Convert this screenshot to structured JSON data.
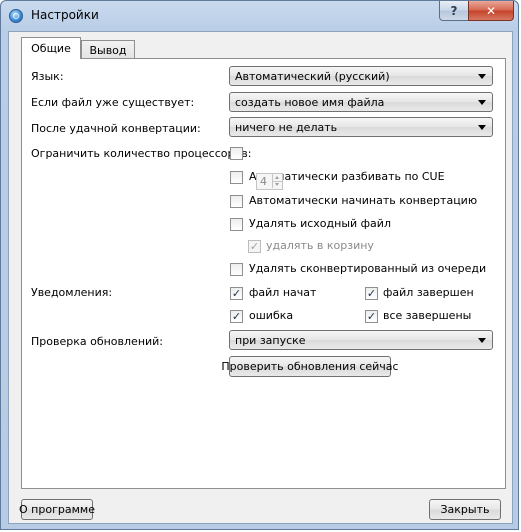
{
  "window": {
    "title": "Настройки",
    "help_label": "?",
    "close_label": "✕"
  },
  "tabs": [
    {
      "label": "Общие"
    },
    {
      "label": "Вывод"
    }
  ],
  "general": {
    "language": {
      "label": "Язык:",
      "value": "Автоматический (русский)"
    },
    "if_exists": {
      "label": "Если файл уже существует:",
      "value": "создать новое имя файла"
    },
    "after_conversion": {
      "label": "После удачной конвертации:",
      "value": "ничего не делать"
    },
    "limit_processors": {
      "label": "Ограничить количество процессоров:",
      "checked": false,
      "value": "4"
    },
    "auto_split_cue": {
      "label": "Автоматически разбивать по CUE",
      "checked": false
    },
    "auto_start": {
      "label": "Автоматически начинать конвертацию",
      "checked": false
    },
    "delete_source": {
      "label": "Удалять исходный файл",
      "checked": false
    },
    "delete_to_trash": {
      "label": "удалять в корзину",
      "checked": true
    },
    "remove_converted": {
      "label": "Удалять сконвертированный из очереди",
      "checked": false
    },
    "notifications": {
      "label": "Уведомления:",
      "file_started": {
        "label": "файл начат",
        "checked": true
      },
      "file_finished": {
        "label": "файл завершен",
        "checked": true
      },
      "error": {
        "label": "ошибка",
        "checked": true
      },
      "all_finished": {
        "label": "все завершены",
        "checked": true
      }
    },
    "update_check": {
      "label": "Проверка обновлений:",
      "value": "при запуске"
    },
    "check_now_label": "Проверить обновления сейчас"
  },
  "footer": {
    "about_label": "О программе",
    "close_label": "Закрыть"
  },
  "icons": {
    "checkmark": "✓"
  }
}
